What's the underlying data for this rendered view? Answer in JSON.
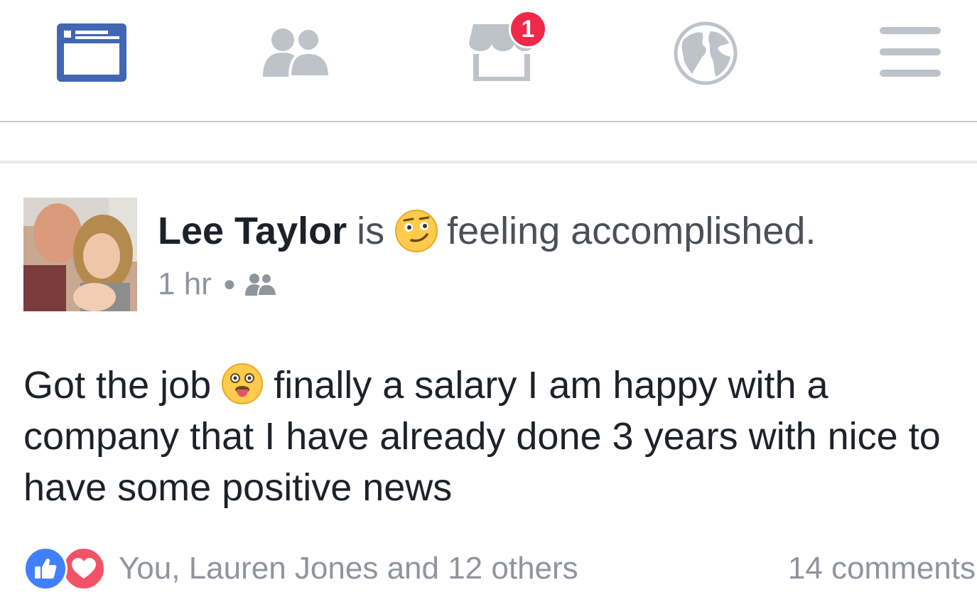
{
  "nav": {
    "items": [
      {
        "name": "news-feed",
        "icon": "news-feed-icon",
        "active": true
      },
      {
        "name": "friend-requests",
        "icon": "friends-icon"
      },
      {
        "name": "marketplace",
        "icon": "marketplace-icon",
        "badge": "1"
      },
      {
        "name": "notifications",
        "icon": "globe-icon"
      },
      {
        "name": "menu",
        "icon": "hamburger-menu-icon"
      }
    ],
    "active_color": "#4267b2",
    "inactive_color": "#bec2c9",
    "badge_color": "#f02849"
  },
  "post": {
    "author": "Lee Taylor",
    "verb": "is",
    "feeling_icon": "smirk-emoji-icon",
    "feeling": "feeling accomplished.",
    "time": "1 hr",
    "privacy_icon": "friends-privacy-icon",
    "text_before_emoji": "Got the job",
    "text_emoji": "tongue-out-emoji-icon",
    "text_after_emoji": "finally a salary I am happy with a company that I have already done 3 years with nice to have some positive news"
  },
  "footer": {
    "reaction_icons": [
      "like-reaction-icon",
      "love-reaction-icon"
    ],
    "reactions_text": "You, Lauren Jones and 12 others",
    "comments_text": "14 comments"
  }
}
